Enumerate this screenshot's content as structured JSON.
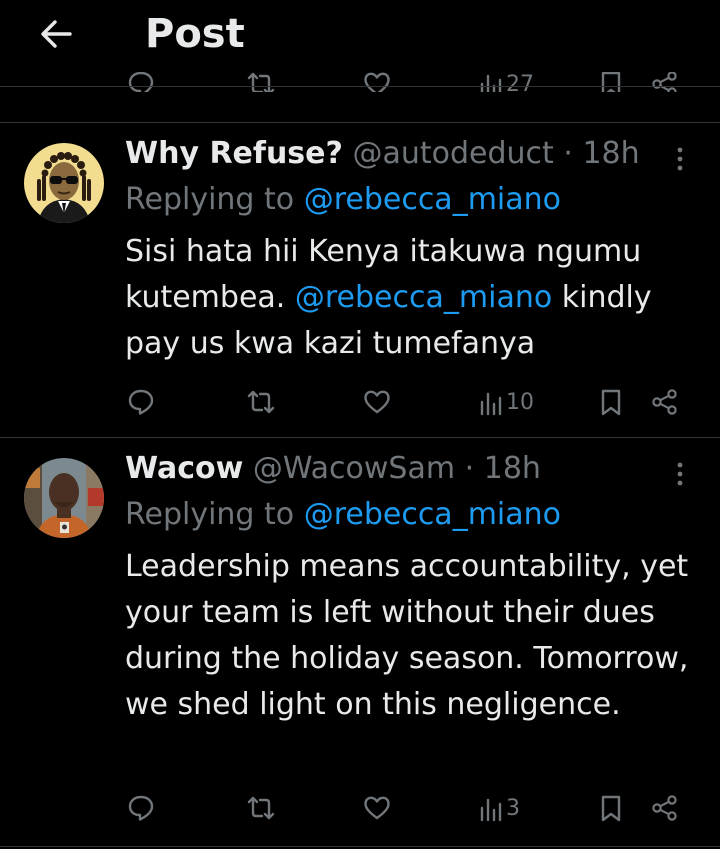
{
  "header": {
    "title": "Post"
  },
  "prev_post": {
    "views": "27"
  },
  "posts": [
    {
      "display_name": "Why Refuse?",
      "handle": "@autodeduct",
      "separator": "·",
      "time": "18h",
      "reply_prefix": "Replying to",
      "reply_to": "@rebecca_miano",
      "text_a": "Sisi hata hii Kenya itakuwa ngumu kutembea.",
      "mention": "@rebecca_miano",
      "text_b": "kindly pay us kwa kazi tumefanya",
      "views": "10"
    },
    {
      "display_name": "Wacow",
      "handle": "@WacowSam",
      "separator": "·",
      "time": "18h",
      "reply_prefix": "Replying to",
      "reply_to": "@rebecca_miano",
      "text": "Leadership means accountability, yet your team is left without their dues during the holiday season. Tomorrow, we shed light on this negligence.",
      "views": "3"
    }
  ],
  "icons": {
    "back": "arrow-left-icon",
    "reply": "speech-bubble-icon",
    "repost": "repost-icon",
    "like": "heart-icon",
    "views": "bar-chart-icon",
    "bookmark": "bookmark-icon",
    "share": "share-icon",
    "more": "vertical-ellipsis-icon"
  },
  "colors": {
    "background": "#000000",
    "text": "#e7e9ea",
    "muted": "#71767b",
    "link": "#1d9bf0",
    "divider": "#2f3336"
  }
}
